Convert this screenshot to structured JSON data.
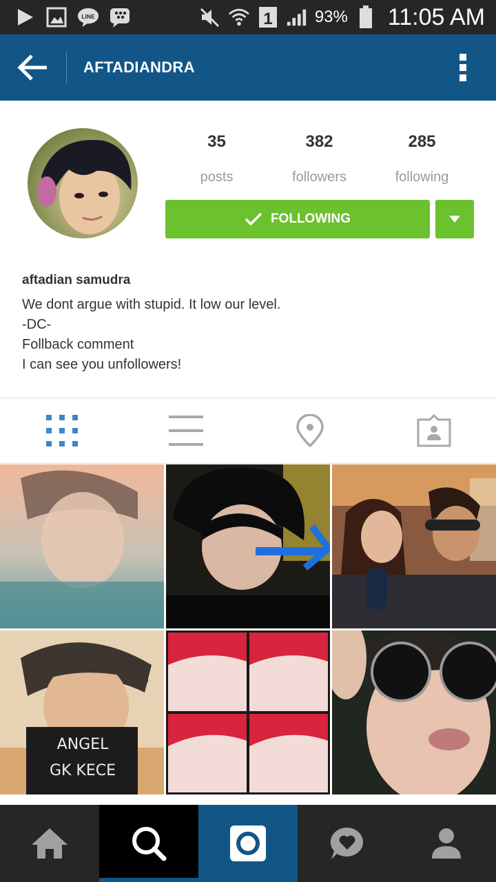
{
  "status_bar": {
    "battery": "93%",
    "time": "11:05 AM",
    "sim_slot": "1",
    "icons": [
      "play-icon",
      "image-icon",
      "line-icon",
      "bbm-icon",
      "mute-icon",
      "wifi-icon",
      "signal-icon",
      "battery-icon"
    ]
  },
  "header": {
    "title": "AFTADIANDRA",
    "back_icon": "back-arrow-icon",
    "menu_icon": "more-vert-icon"
  },
  "profile": {
    "posts_count": "35",
    "posts_label": "posts",
    "followers_count": "382",
    "followers_label": "followers",
    "following_count": "285",
    "following_label": "following",
    "follow_button": "FOLLOWING",
    "full_name": "aftadian samudra",
    "bio_lines": [
      "We dont argue with stupid. It low our level.",
      "-DC-",
      "Follback comment",
      "I can see you unfollowers!"
    ]
  },
  "tabs": [
    {
      "icon": "grid-view-icon",
      "active": true
    },
    {
      "icon": "list-view-icon",
      "active": false
    },
    {
      "icon": "location-pin-icon",
      "active": false
    },
    {
      "icon": "tagged-photos-icon",
      "active": false
    }
  ],
  "bottom_nav": [
    {
      "icon": "home-icon"
    },
    {
      "icon": "search-icon",
      "active": true
    },
    {
      "icon": "camera-icon"
    },
    {
      "icon": "activity-icon"
    },
    {
      "icon": "profile-icon"
    }
  ],
  "colors": {
    "header_bg": "#125688",
    "follow_green": "#6bc12e",
    "active_tab": "#3f86c8",
    "nav_bg": "#262626"
  }
}
